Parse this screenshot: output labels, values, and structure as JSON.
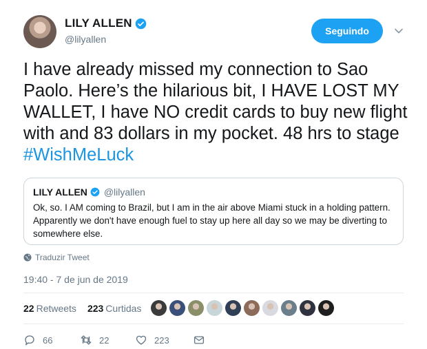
{
  "author": {
    "name": "LILY ALLEN",
    "handle": "@lilyallen"
  },
  "follow_button_label": "Seguindo",
  "tweet": {
    "text": "I have already missed my connection to Sao Paolo. Here’s the hilarious bit, I HAVE LOST MY WALLET, I have NO credit cards to buy new flight with  and 83 dollars in my pocket. 48 hrs to stage ",
    "hashtag": "#WishMeLuck"
  },
  "quoted_tweet": {
    "name": "LILY ALLEN",
    "handle": "@lilyallen",
    "text": "Ok, so. I AM coming to Brazil, but I am in the air above Miami stuck in a holding pattern. Apparently we don't have enough fuel to stay up here all day so we may be diverting to somewhere else."
  },
  "translate_label": "Traduzir Tweet",
  "timestamp": "19:40 - 7 de jun de 2019",
  "stats": {
    "retweets_count": "22",
    "retweets_label": "Retweets",
    "likes_count": "223",
    "likes_label": "Curtidas"
  },
  "liker_avatar_colors": [
    "#3b3b3b",
    "#3a4f7a",
    "#8a8f6a",
    "#c9d6d9",
    "#2f3f55",
    "#8c6b5a",
    "#d9d9e0",
    "#6b7e8c",
    "#2f3340",
    "#1e1e1e"
  ],
  "actions": {
    "reply_count": "66",
    "retweet_count": "22",
    "like_count": "223"
  },
  "colors": {
    "brand_blue": "#1da1f2",
    "link_blue": "#1b95e0",
    "secondary_text": "#657786"
  }
}
